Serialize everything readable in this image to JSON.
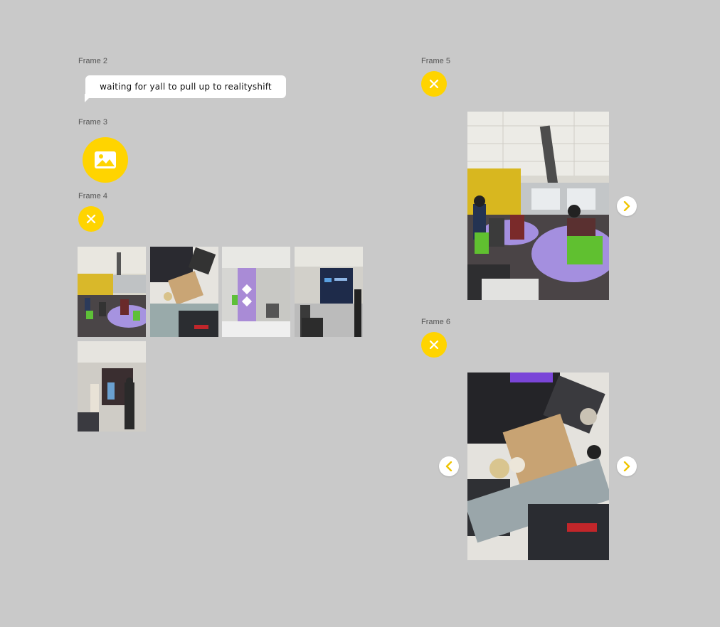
{
  "frames": {
    "frame2": {
      "label": "Frame 2",
      "message": "waiting for yall to pull up to realityshift"
    },
    "frame3": {
      "label": "Frame 3",
      "icon": "image-icon"
    },
    "frame4": {
      "label": "Frame 4",
      "icon": "close-icon",
      "thumbnail_count": 5
    },
    "frame5": {
      "label": "Frame 5",
      "icon": "close-icon",
      "nav": [
        "chevron-right-icon"
      ]
    },
    "frame6": {
      "label": "Frame 6",
      "icon": "close-icon",
      "nav": [
        "chevron-left-icon",
        "chevron-right-icon"
      ]
    }
  },
  "colors": {
    "background": "#c9c9c9",
    "accent": "#ffd400",
    "bubble": "#ffffff"
  }
}
